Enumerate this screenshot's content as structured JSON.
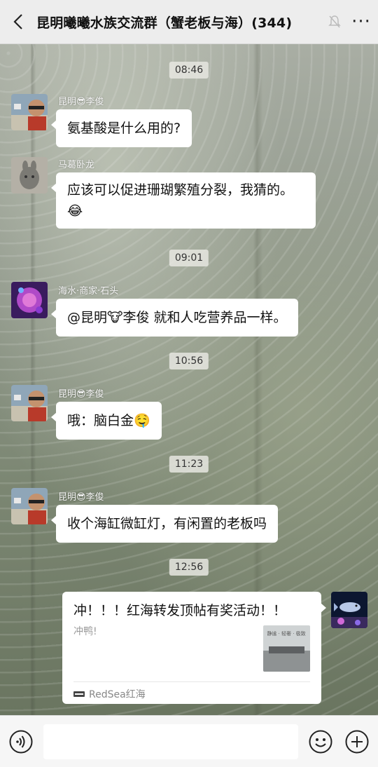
{
  "header": {
    "title": "昆明曦曦水族交流群（蟹老板与海）(344)",
    "more_label": "···"
  },
  "messages": {
    "t1": "08:46",
    "m1_name": "昆明😎李俊",
    "m1_text": "氨基酸是什么用的?",
    "m2_name": "马葛卧龙",
    "m2_text": "应该可以促进珊瑚繁殖分裂，我猜的。",
    "m2_emoji": "😂",
    "t2": "09:01",
    "m3_name": "海水·商家·石头",
    "m3_text": "@昆明🐮李俊  就和人吃营养品一样。",
    "t3": "10:56",
    "m4_name": "昆明😎李俊",
    "m4_text": "哦：脑白金🤤",
    "t4": "11:23",
    "m5_name": "昆明😎李俊",
    "m5_text": "收个海缸微缸灯，有闲置的老板吗",
    "t5": "12:56"
  },
  "card": {
    "title": "冲！！！红海转发顶帖有奖活动！！",
    "desc": "冲鸭!",
    "source": "RedSea红海",
    "thumb_caption": "静谧 · 轻奢 · 极致"
  },
  "icons": {
    "back": "chevron-left-icon",
    "mute": "muted-bell-icon",
    "voice": "voice-icon",
    "emoji": "emoji-icon",
    "plus": "plus-icon"
  }
}
